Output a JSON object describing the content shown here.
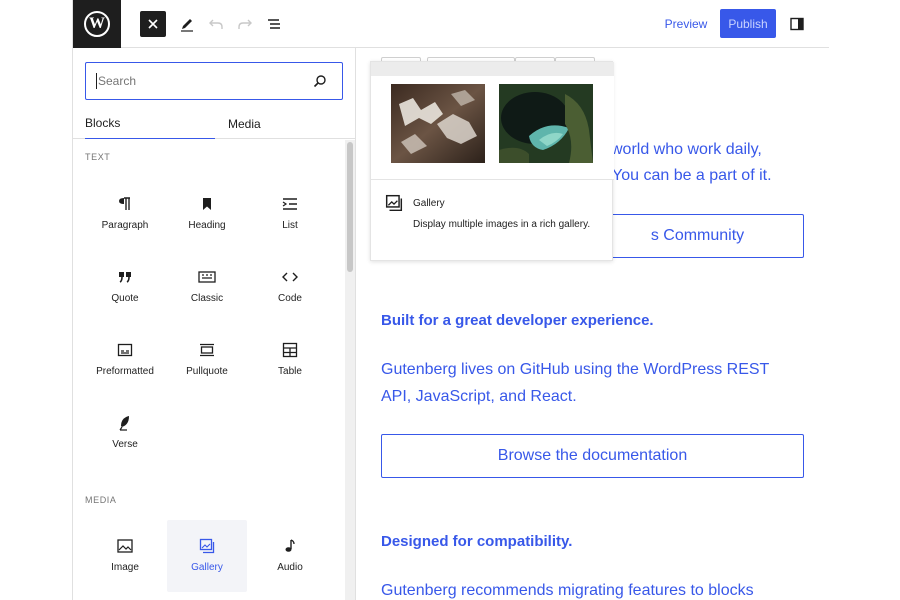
{
  "toolbar": {
    "preview_label": "Preview",
    "publish_label": "Publish"
  },
  "inserter": {
    "search_placeholder": "Search",
    "tabs": [
      {
        "label": "Blocks",
        "active": true
      },
      {
        "label": "Media",
        "active": false
      }
    ],
    "sections": [
      {
        "title": "TEXT",
        "blocks": [
          {
            "label": "Paragraph",
            "icon": "paragraph-icon"
          },
          {
            "label": "Heading",
            "icon": "heading-icon"
          },
          {
            "label": "List",
            "icon": "list-icon"
          },
          {
            "label": "Quote",
            "icon": "quote-icon"
          },
          {
            "label": "Classic",
            "icon": "classic-icon"
          },
          {
            "label": "Code",
            "icon": "code-icon"
          },
          {
            "label": "Preformatted",
            "icon": "preformatted-icon"
          },
          {
            "label": "Pullquote",
            "icon": "pullquote-icon"
          },
          {
            "label": "Table",
            "icon": "table-icon"
          },
          {
            "label": "Verse",
            "icon": "verse-icon"
          }
        ]
      },
      {
        "title": "MEDIA",
        "blocks": [
          {
            "label": "Image",
            "icon": "image-icon"
          },
          {
            "label": "Gallery",
            "icon": "gallery-icon",
            "hovered": true
          },
          {
            "label": "Audio",
            "icon": "audio-icon"
          }
        ]
      }
    ]
  },
  "preview": {
    "title": "Gallery",
    "description": "Display multiple images in a rich gallery."
  },
  "content": {
    "para1_line1": "world who work daily,",
    "para1_line2": "You can be a part of it.",
    "button1_label": "s Community",
    "heading1": "Built for a great developer experience.",
    "para2_line1": "Gutenberg lives on GitHub using the WordPress REST",
    "para2_line2": "API, JavaScript, and React.",
    "button2_label": "Browse the documentation",
    "heading2": "Designed for compatibility.",
    "para3_line1": "Gutenberg recommends migrating features to blocks"
  },
  "colors": {
    "accent": "#3858e9",
    "dark": "#1e1e1e",
    "border": "#e0e0e0",
    "muted": "#757575"
  }
}
